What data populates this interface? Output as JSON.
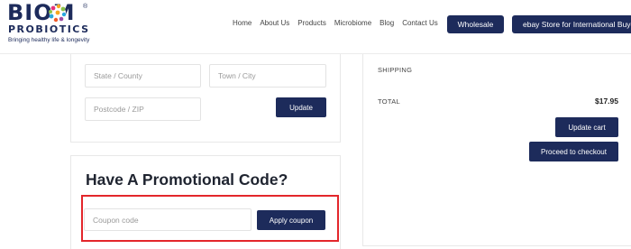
{
  "brand": {
    "word": "BIOM",
    "reg_mark": "®",
    "sub": "PROBIOTICS",
    "tagline": "Bringing healthy life & longevity",
    "dot_colors": [
      "#e5337a",
      "#f7a823",
      "#8bc34a",
      "#29a8df",
      "#9c4aa5",
      "#f15a29"
    ]
  },
  "nav": {
    "items": [
      "Home",
      "About Us",
      "Products",
      "Microbiome",
      "Blog",
      "Contact Us"
    ],
    "wholesale_label": "Wholesale",
    "ebay_label": "ebay Store for International Buyers"
  },
  "address_form": {
    "state_placeholder": "State / County",
    "town_placeholder": "Town / City",
    "postcode_placeholder": "Postcode / ZIP",
    "update_label": "Update"
  },
  "promo": {
    "title": "Have A Promotional Code?",
    "coupon_placeholder": "Coupon code",
    "apply_label": "Apply coupon"
  },
  "totals": {
    "shipping_label": "SHIPPING",
    "total_label": "TOTAL",
    "total_value": "$17.95",
    "update_cart_label": "Update cart",
    "checkout_label": "Proceed to checkout"
  },
  "colors": {
    "primary": "#1d2b5b",
    "highlight": "#e3262b"
  }
}
